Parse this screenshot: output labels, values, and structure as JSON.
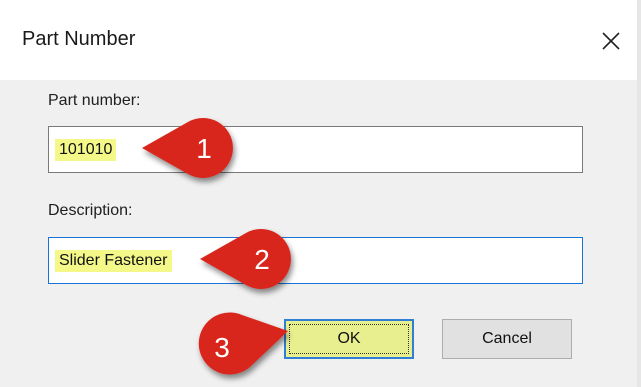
{
  "dialog": {
    "title": "Part Number",
    "close_icon": "close-icon"
  },
  "fields": {
    "part_number_label": "Part number:",
    "part_number_value": "101010",
    "description_label": "Description:",
    "description_value": "Slider Fastener"
  },
  "buttons": {
    "ok_label": "OK",
    "cancel_label": "Cancel"
  },
  "callouts": [
    {
      "number": "1"
    },
    {
      "number": "2"
    },
    {
      "number": "3"
    }
  ],
  "colors": {
    "highlight": "#f4f888",
    "callout_red": "#d9251c",
    "focus_blue": "#2f7fd6"
  }
}
